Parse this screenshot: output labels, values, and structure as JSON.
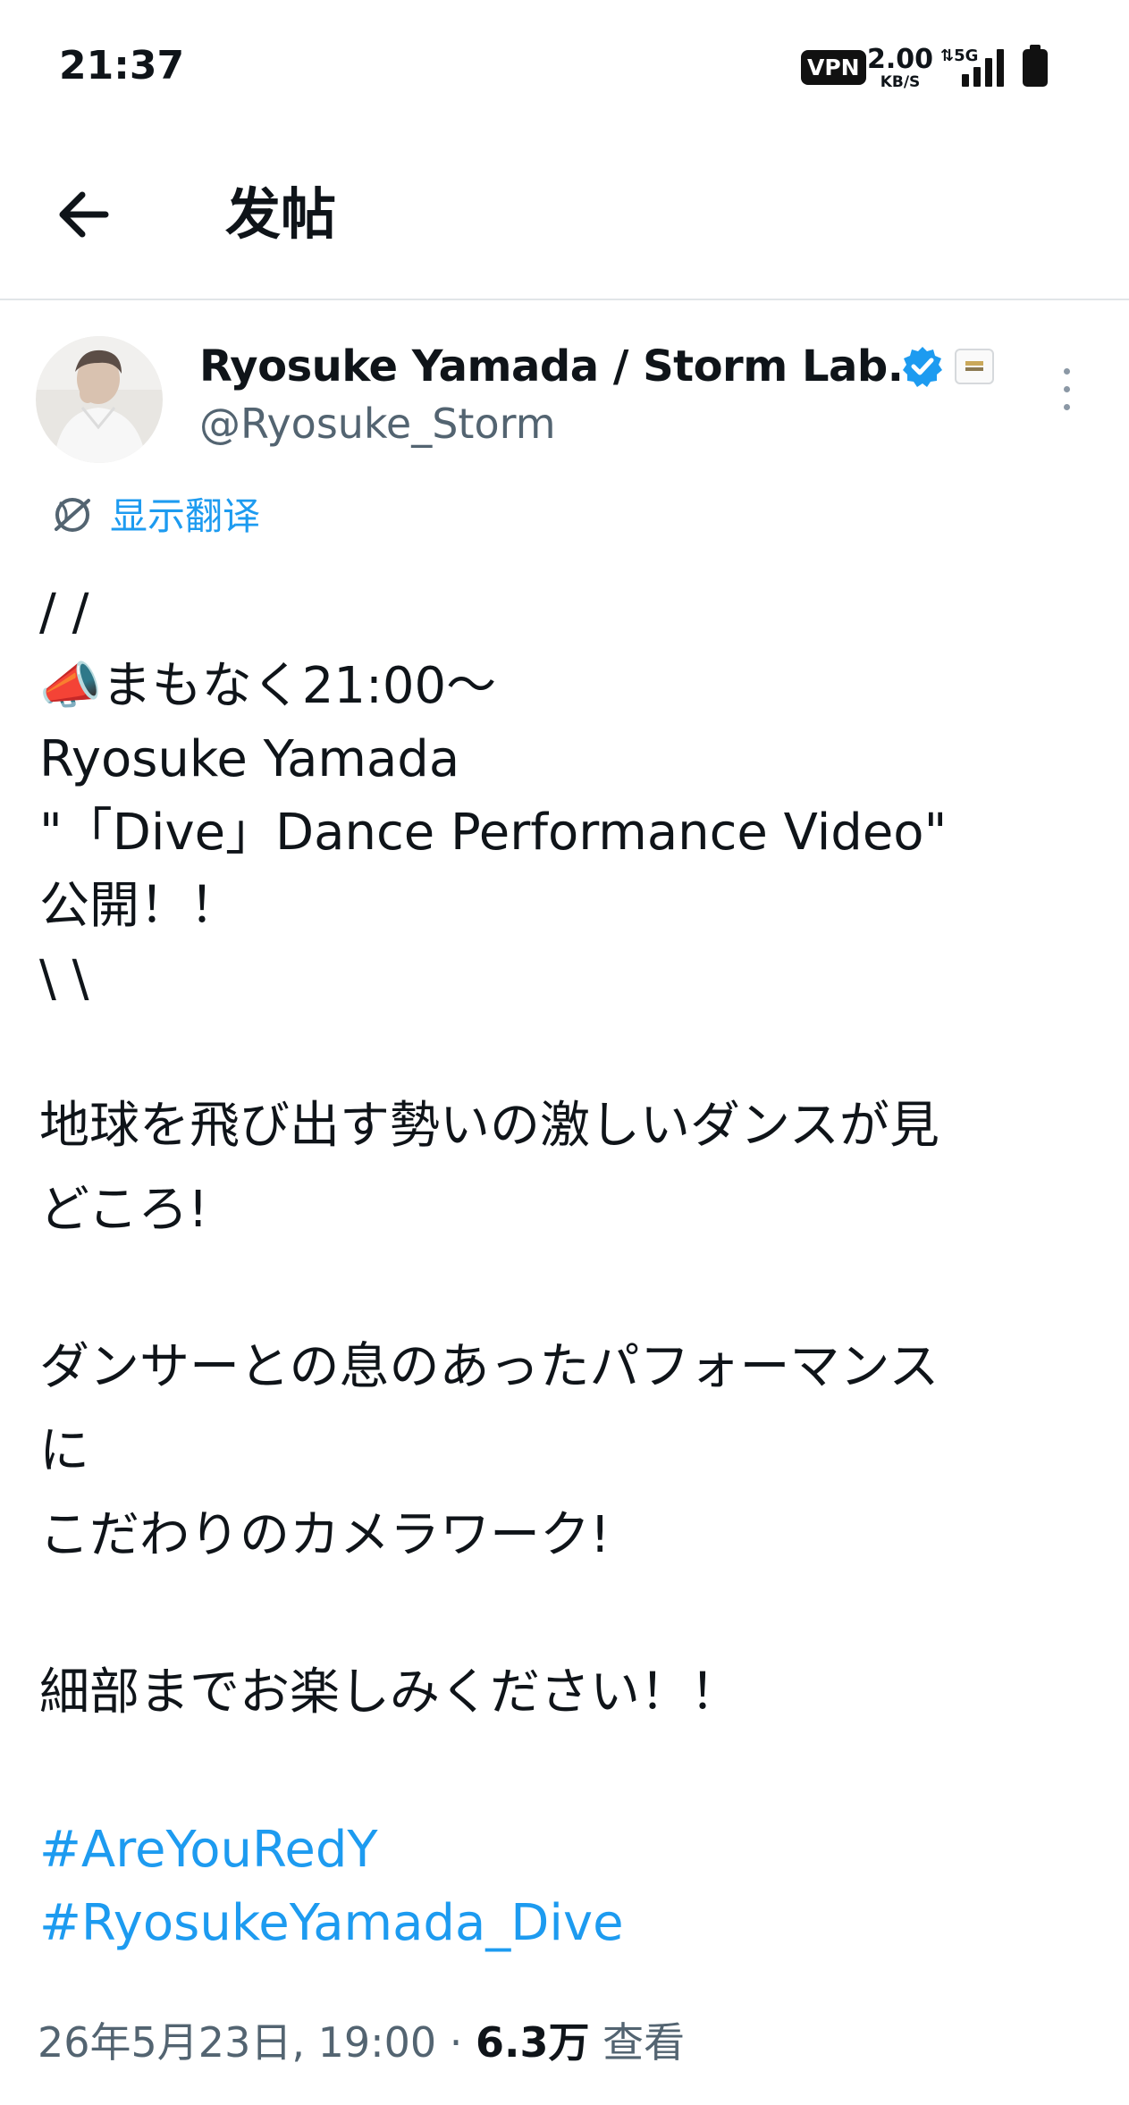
{
  "status_bar": {
    "time": "21:37",
    "vpn": "VPN",
    "speed_value": "2.00",
    "speed_unit": "KB/S",
    "network": "5G"
  },
  "header": {
    "title": "发帖",
    "back_icon": "arrow-left-icon"
  },
  "author": {
    "name": "Ryosuke Yamada / Storm Lab...",
    "handle": "@Ryosuke_Storm",
    "verified_icon": "verified-badge-icon",
    "verified_color": "#1d9bf0"
  },
  "translate": {
    "label": "显示翻译",
    "icon": "translate-globe-icon"
  },
  "tweet": {
    "line1": "/ /",
    "line2": "📣まもなく21:00〜",
    "line3": "Ryosuke Yamada",
    "line4": "\"「Dive」Dance Performance Video\"",
    "line5": "公開！！",
    "line6": "\\ \\",
    "line7": "地球を飛び出す勢いの激しいダンスが見",
    "line8": "どころ!",
    "line9": "ダンサーとの息のあったパフォーマンス",
    "line10": "に",
    "line11": "こだわりのカメラワーク!",
    "line12": "細部までお楽しみください！！",
    "hashtag1": "#AreYouRedY",
    "hashtag2": "#RyosukeYamada_Dive"
  },
  "meta": {
    "date": "26年5月23日, 19:00 · ",
    "views": "6.3万",
    "views_label": " 查看"
  },
  "colors": {
    "accent": "#1d9bf0",
    "secondary_text": "#536471",
    "primary_text": "#0f1419"
  }
}
